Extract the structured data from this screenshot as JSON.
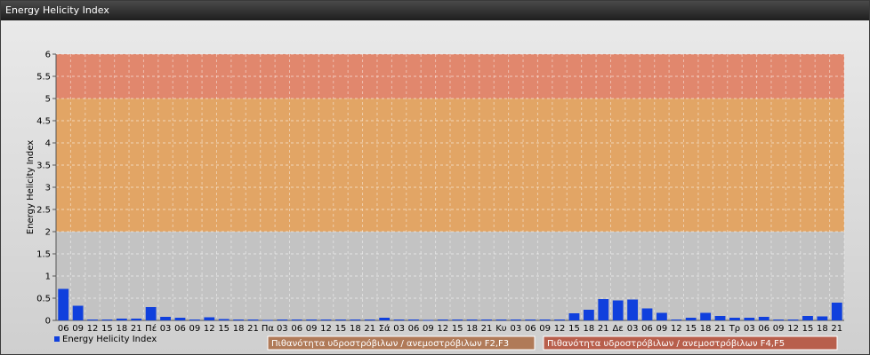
{
  "window": {
    "title": "Energy Helicity Index"
  },
  "chart_data": {
    "type": "bar",
    "ylabel": "Energy Helicity Index",
    "ylim": [
      0,
      6
    ],
    "yticks": [
      0,
      0.5,
      1,
      1.5,
      2,
      2.5,
      3,
      3.5,
      4,
      4.5,
      5,
      5.5,
      6
    ],
    "categories": [
      "06",
      "09",
      "12",
      "15",
      "18",
      "21",
      "Πέ",
      "03",
      "06",
      "09",
      "12",
      "15",
      "18",
      "21",
      "Πα",
      "03",
      "06",
      "09",
      "12",
      "15",
      "18",
      "21",
      "Σά",
      "03",
      "06",
      "09",
      "12",
      "15",
      "18",
      "21",
      "Κυ",
      "03",
      "06",
      "09",
      "12",
      "15",
      "18",
      "21",
      "Δε",
      "03",
      "06",
      "09",
      "12",
      "15",
      "18",
      "21",
      "Τρ",
      "03",
      "06",
      "09",
      "12",
      "15",
      "18",
      "21"
    ],
    "series": [
      {
        "name": "Energy Helicity Index",
        "color": "#1040dd",
        "values": [
          0.71,
          0.33,
          0.02,
          0.02,
          0.04,
          0.04,
          0.3,
          0.08,
          0.06,
          0.02,
          0.07,
          0.03,
          0.02,
          0.02,
          0.01,
          0.02,
          0.02,
          0.02,
          0.02,
          0.02,
          0.02,
          0.02,
          0.06,
          0.02,
          0.02,
          0.01,
          0.02,
          0.02,
          0.02,
          0.02,
          0.02,
          0.02,
          0.02,
          0.02,
          0.02,
          0.16,
          0.24,
          0.48,
          0.45,
          0.47,
          0.27,
          0.17,
          0.02,
          0.06,
          0.17,
          0.1,
          0.06,
          0.06,
          0.08,
          0.02,
          0.02,
          0.1,
          0.09,
          0.4
        ]
      }
    ],
    "zones": [
      {
        "from": 2,
        "to": 5,
        "label": "Πιθανότητα υδροστρόβιλων / ανεμοστρόβιλων F2,F3",
        "color": "#e8a055"
      },
      {
        "from": 5,
        "to": 6,
        "label": "Πιθανότητα υδροστρόβιλων / ανεμοστρόβιλων F4,F5",
        "color": "#e67c5e"
      }
    ],
    "grid": true,
    "legend": "bottom-left"
  }
}
